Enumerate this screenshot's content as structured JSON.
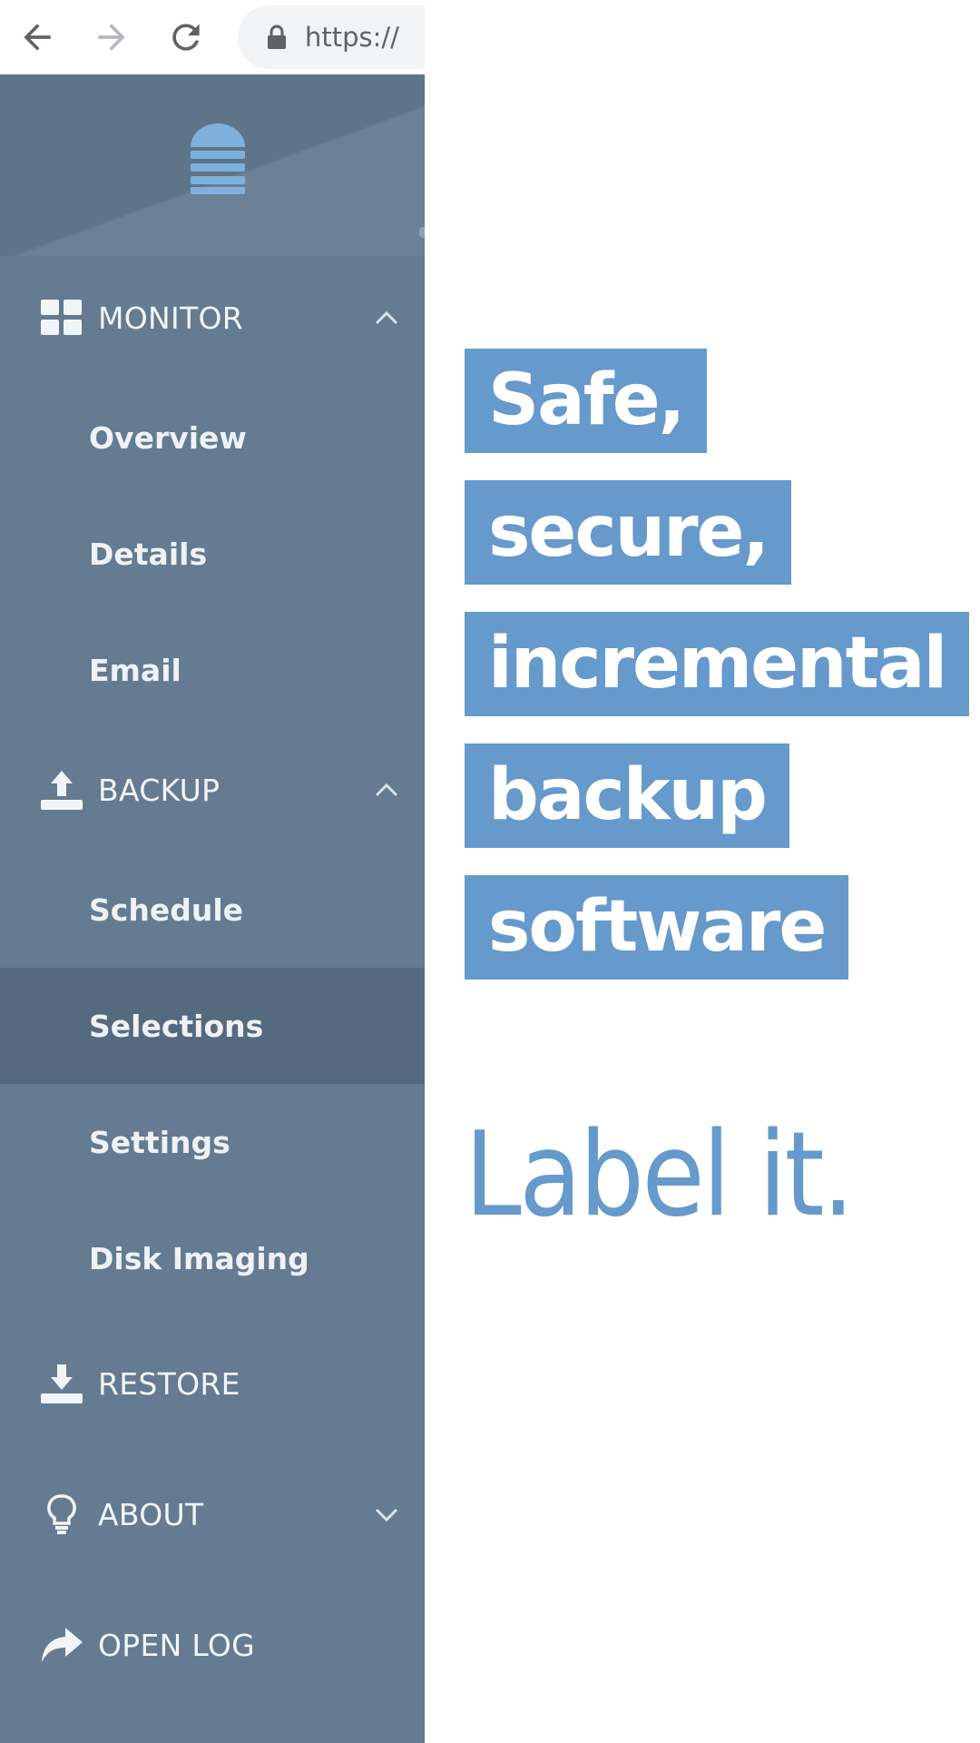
{
  "browser": {
    "url": "https://"
  },
  "sidebar": {
    "sections": {
      "monitor": {
        "label": "MONITOR",
        "items": [
          "Overview",
          "Details",
          "Email"
        ]
      },
      "backup": {
        "label": "BACKUP",
        "items": [
          "Schedule",
          "Selections",
          "Settings",
          "Disk Imaging"
        ],
        "active_item": "Selections"
      },
      "restore": {
        "label": "RESTORE"
      },
      "about": {
        "label": "ABOUT"
      },
      "open_log": {
        "label": "OPEN LOG"
      }
    }
  },
  "main": {
    "headline": [
      "Safe,",
      "secure,",
      "incremental",
      "backup",
      "software"
    ],
    "tagline": "Label it."
  },
  "colors": {
    "sidebar_bg": "#647b91",
    "sidebar_active": "#566a7f",
    "accent_blue": "#6699cc",
    "logo_blue": "#7fb0dc"
  },
  "icons": {
    "monitor": "dashboard-icon",
    "backup": "upload-icon",
    "restore": "download-icon",
    "about": "lightbulb-icon",
    "open_log": "share-arrow-icon"
  }
}
